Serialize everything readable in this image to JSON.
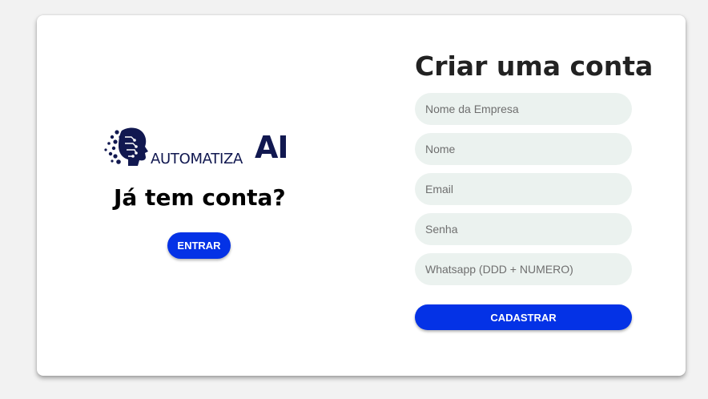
{
  "brand": {
    "logo_text": "AUTOMATIZA",
    "logo_ai": "AI",
    "logo_icon": "ai-head-circuit-icon",
    "color": "#111850"
  },
  "login_panel": {
    "heading": "Já tem conta?",
    "enter_button": "ENTRAR"
  },
  "signup_form": {
    "title": "Criar uma conta",
    "fields": [
      {
        "placeholder": "Nome da Empresa",
        "value": ""
      },
      {
        "placeholder": "Nome",
        "value": ""
      },
      {
        "placeholder": "Email",
        "value": ""
      },
      {
        "placeholder": "Senha",
        "value": ""
      },
      {
        "placeholder": "Whatsapp (DDD + NUMERO)",
        "value": ""
      }
    ],
    "submit_button": "CADASTRAR"
  },
  "colors": {
    "accent": "#0432e6",
    "field_background": "#ebf2ef",
    "page_background": "#f2f2f2"
  }
}
